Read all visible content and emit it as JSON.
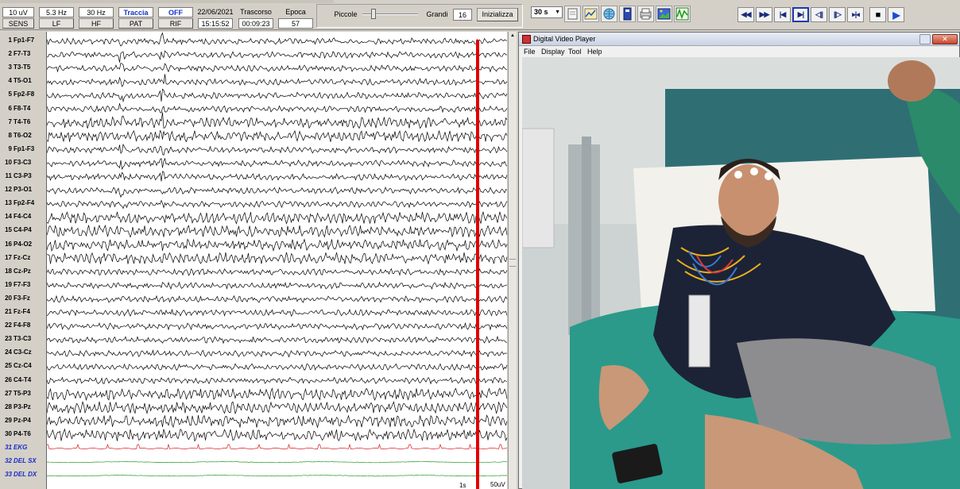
{
  "toolbar": {
    "sens": {
      "value": "10 uV",
      "label": "SENS"
    },
    "lf": {
      "value": "5.3 Hz",
      "label": "LF"
    },
    "hf": {
      "value": "30 Hz",
      "label": "HF"
    },
    "pat": {
      "value": "Traccia",
      "label": "PAT"
    },
    "rif": {
      "value": "OFF",
      "label": "RIF"
    },
    "date": "22/06/2021",
    "time": "15:15:52",
    "trascorso": {
      "label": "Trascorso",
      "value": "00:09:23"
    },
    "epoca": {
      "label": "Epoca",
      "value": "57"
    },
    "piccole_label": "Piccole",
    "grandi_label": "Grandi",
    "grandi_value": "16",
    "inizializza_label": "Inizializza",
    "time_window": "30 s"
  },
  "icons": {
    "save": "save-icon",
    "chart": "chart-icon",
    "globe": "globe-icon",
    "book": "book-icon",
    "print": "print-icon",
    "image": "image-icon",
    "wave": "wave-icon"
  },
  "playback": {
    "rewind": "◀◀",
    "fast_forward": "▶▶",
    "step_back": "|◀",
    "step_forward": "▶|",
    "frame_back": "◁||",
    "frame_forward": "||▷",
    "split": "▸|◂",
    "stop": "■",
    "play": "▶"
  },
  "channels": [
    {
      "num": "1",
      "name": "Fp1-F7"
    },
    {
      "num": "2",
      "name": "F7-T3"
    },
    {
      "num": "3",
      "name": "T3-T5"
    },
    {
      "num": "4",
      "name": "T5-O1"
    },
    {
      "num": "5",
      "name": "Fp2-F8"
    },
    {
      "num": "6",
      "name": "F8-T4"
    },
    {
      "num": "7",
      "name": "T4-T6"
    },
    {
      "num": "8",
      "name": "T6-O2"
    },
    {
      "num": "9",
      "name": "Fp1-F3"
    },
    {
      "num": "10",
      "name": "F3-C3"
    },
    {
      "num": "11",
      "name": "C3-P3"
    },
    {
      "num": "12",
      "name": "P3-O1"
    },
    {
      "num": "13",
      "name": "Fp2-F4"
    },
    {
      "num": "14",
      "name": "F4-C4"
    },
    {
      "num": "15",
      "name": "C4-P4"
    },
    {
      "num": "16",
      "name": "P4-O2"
    },
    {
      "num": "17",
      "name": "Fz-Cz"
    },
    {
      "num": "18",
      "name": "Cz-Pz"
    },
    {
      "num": "19",
      "name": "F7-F3"
    },
    {
      "num": "20",
      "name": "F3-Fz"
    },
    {
      "num": "21",
      "name": "Fz-F4"
    },
    {
      "num": "22",
      "name": "F4-F8"
    },
    {
      "num": "23",
      "name": "T3-C3"
    },
    {
      "num": "24",
      "name": "C3-Cz"
    },
    {
      "num": "25",
      "name": "Cz-C4"
    },
    {
      "num": "26",
      "name": "C4-T4"
    },
    {
      "num": "27",
      "name": "T5-P3"
    },
    {
      "num": "28",
      "name": "P3-Pz"
    },
    {
      "num": "29",
      "name": "Pz-P4"
    },
    {
      "num": "30",
      "name": "P4-T6"
    },
    {
      "num": "31",
      "name": "EKG"
    },
    {
      "num": "32",
      "name": "DEL SX"
    },
    {
      "num": "33",
      "name": "DEL DX"
    }
  ],
  "eeg": {
    "scale_label": "50uV",
    "time_label": "1s",
    "cursor_color": "#e00000",
    "trace_color": "#000000",
    "ekg_color": "#d42020",
    "del_color": "#2a9a2a"
  },
  "video_player": {
    "title": "Digital Video Player",
    "menu": [
      "File",
      "Display",
      "Tool",
      "Help"
    ]
  }
}
